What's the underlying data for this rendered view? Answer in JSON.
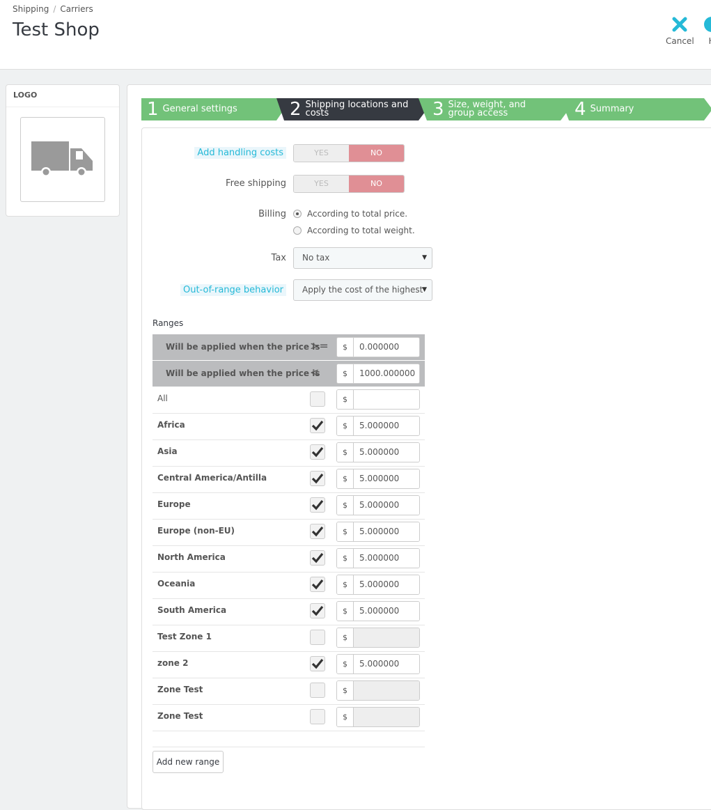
{
  "breadcrumb": {
    "parent": "Shipping",
    "sep": "/",
    "current": "Carriers"
  },
  "page": {
    "title": "Test Shop"
  },
  "toolbar": {
    "cancel_label": "Cancel",
    "help_label": "H"
  },
  "logo_panel": {
    "heading": "LOGO"
  },
  "wizard": {
    "steps": [
      {
        "num": "1",
        "label": "General settings",
        "state": "done"
      },
      {
        "num": "2",
        "label": "Shipping locations and costs",
        "state": "active"
      },
      {
        "num": "3",
        "label": "Size, weight, and group access",
        "state": "done"
      },
      {
        "num": "4",
        "label": "Summary",
        "state": "done"
      }
    ]
  },
  "form": {
    "handling": {
      "label": "Add handling costs",
      "yes": "YES",
      "no": "NO"
    },
    "free_shipping": {
      "label": "Free shipping",
      "yes": "YES",
      "no": "NO"
    },
    "billing": {
      "label": "Billing",
      "options": [
        "According to total price.",
        "According to total weight."
      ],
      "selected": 0
    },
    "tax": {
      "label": "Tax",
      "value": "No tax"
    },
    "out_of_range": {
      "label": "Out-of-range behavior",
      "value": "Apply the cost of the highest"
    }
  },
  "ranges": {
    "title": "Ranges",
    "from": {
      "label": "Will be applied when the price is",
      "operator": ">=",
      "currency": "$",
      "value": "0.000000"
    },
    "to": {
      "label": "Will be applied when the price is",
      "operator": "<",
      "currency": "$",
      "value": "1000.000000"
    },
    "zones": [
      {
        "name": "All",
        "checked": false,
        "currency": "$",
        "value": "",
        "disabled": false,
        "bold": false
      },
      {
        "name": "Africa",
        "checked": true,
        "currency": "$",
        "value": "5.000000",
        "disabled": false,
        "bold": true
      },
      {
        "name": "Asia",
        "checked": true,
        "currency": "$",
        "value": "5.000000",
        "disabled": false,
        "bold": true
      },
      {
        "name": "Central America/Antilla",
        "checked": true,
        "currency": "$",
        "value": "5.000000",
        "disabled": false,
        "bold": true
      },
      {
        "name": "Europe",
        "checked": true,
        "currency": "$",
        "value": "5.000000",
        "disabled": false,
        "bold": true
      },
      {
        "name": "Europe (non-EU)",
        "checked": true,
        "currency": "$",
        "value": "5.000000",
        "disabled": false,
        "bold": true
      },
      {
        "name": "North America",
        "checked": true,
        "currency": "$",
        "value": "5.000000",
        "disabled": false,
        "bold": true
      },
      {
        "name": "Oceania",
        "checked": true,
        "currency": "$",
        "value": "5.000000",
        "disabled": false,
        "bold": true
      },
      {
        "name": "South America",
        "checked": true,
        "currency": "$",
        "value": "5.000000",
        "disabled": false,
        "bold": true
      },
      {
        "name": "Test Zone 1",
        "checked": false,
        "currency": "$",
        "value": "",
        "disabled": true,
        "bold": true
      },
      {
        "name": "zone 2",
        "checked": true,
        "currency": "$",
        "value": "5.000000",
        "disabled": false,
        "bold": true
      },
      {
        "name": "Zone Test",
        "checked": false,
        "currency": "$",
        "value": "",
        "disabled": true,
        "bold": true
      },
      {
        "name": "Zone Test",
        "checked": false,
        "currency": "$",
        "value": "",
        "disabled": true,
        "bold": true
      }
    ],
    "add_button": "Add new range"
  },
  "colors": {
    "accent": "#25b9d7",
    "step_done": "#72c279",
    "step_active": "#363a41",
    "switch_no": "#e08f95"
  }
}
